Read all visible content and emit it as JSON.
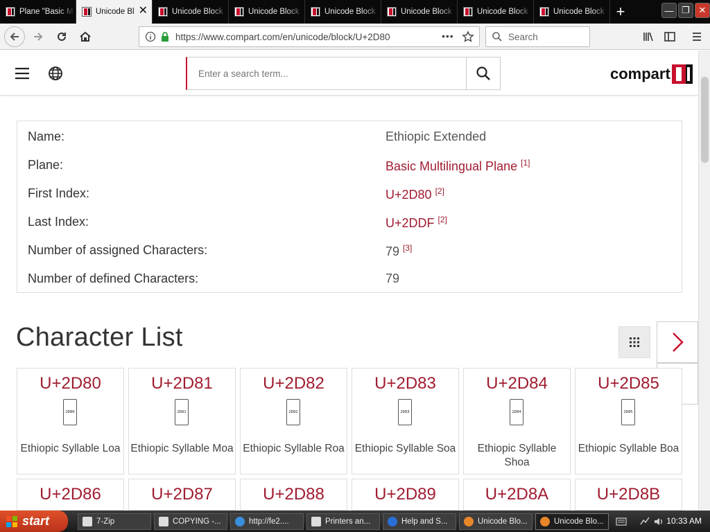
{
  "browser": {
    "tabs": [
      {
        "title": "Plane \"Basic M",
        "active": false
      },
      {
        "title": "Unicode Bl",
        "active": true
      },
      {
        "title": "Unicode Block",
        "active": false
      },
      {
        "title": "Unicode Block",
        "active": false
      },
      {
        "title": "Unicode Block",
        "active": false
      },
      {
        "title": "Unicode Block",
        "active": false
      },
      {
        "title": "Unicode Block",
        "active": false
      },
      {
        "title": "Unicode Block",
        "active": false
      }
    ],
    "new_tab": "+",
    "close_tab": "✕",
    "window": {
      "minimize": "—",
      "restore": "❐",
      "close": "✕"
    },
    "url": "https://www.compart.com/en/unicode/block/U+2D80",
    "search_placeholder": "Search"
  },
  "site": {
    "search_placeholder": "Enter a search term...",
    "logo_text": "compart",
    "brand_color": "#c8102e"
  },
  "info": {
    "name_label": "Name:",
    "name_value": "Ethiopic Extended",
    "plane_label": "Plane:",
    "plane_value": "Basic Multilingual Plane",
    "plane_ref": "[1]",
    "first_label": "First Index:",
    "first_value": "U+2D80",
    "first_ref": "[2]",
    "last_label": "Last Index:",
    "last_value": "U+2DDF",
    "last_ref": "[2]",
    "assigned_label": "Number of assigned Characters:",
    "assigned_value": "79",
    "assigned_ref": "[3]",
    "defined_label": "Number of defined Characters:",
    "defined_value": "79"
  },
  "charlist": {
    "title": "Character List",
    "cards": [
      {
        "code": "U+2D80",
        "glyph": "2D80",
        "name": "Ethiopic Syllable Loa"
      },
      {
        "code": "U+2D81",
        "glyph": "2D81",
        "name": "Ethiopic Syllable Moa"
      },
      {
        "code": "U+2D82",
        "glyph": "2D82",
        "name": "Ethiopic Syllable Roa"
      },
      {
        "code": "U+2D83",
        "glyph": "2D83",
        "name": "Ethiopic Syllable Soa"
      },
      {
        "code": "U+2D84",
        "glyph": "2D84",
        "name": "Ethiopic Syllable Shoa"
      },
      {
        "code": "U+2D85",
        "glyph": "2D85",
        "name": "Ethiopic Syllable Boa"
      },
      {
        "code": "U+2D86",
        "glyph": "",
        "name": ""
      },
      {
        "code": "U+2D87",
        "glyph": "",
        "name": ""
      },
      {
        "code": "U+2D88",
        "glyph": "",
        "name": ""
      },
      {
        "code": "U+2D89",
        "glyph": "",
        "name": ""
      },
      {
        "code": "U+2D8A",
        "glyph": "",
        "name": ""
      },
      {
        "code": "U+2D8B",
        "glyph": "",
        "name": ""
      }
    ]
  },
  "taskbar": {
    "start": "start",
    "items": [
      "7-Zip",
      "COPYING -...",
      "http://fe2....",
      "Printers an...",
      "Help and S...",
      "Unicode Blo...",
      "Unicode Blo..."
    ],
    "clock": "10:33 AM"
  }
}
